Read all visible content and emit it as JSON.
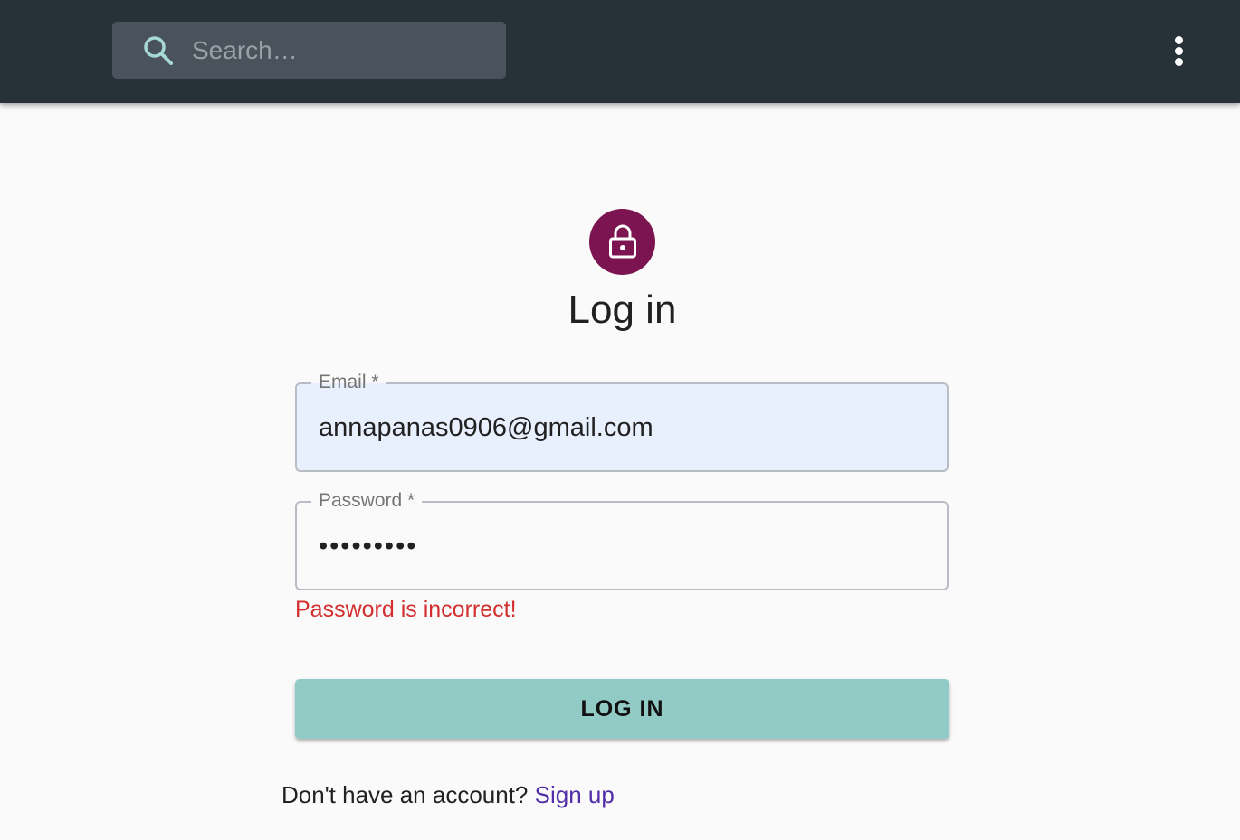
{
  "search": {
    "placeholder": "Search…"
  },
  "header": {
    "menu_icon": "more-vert-icon"
  },
  "login": {
    "icon": "lock-icon",
    "title": "Log in",
    "email_label": "Email *",
    "email_value": "annapanas0906@gmail.com",
    "password_label": "Password *",
    "password_value": "•••••••••",
    "error": "Password is incorrect!",
    "submit_label": "LOG IN",
    "footer_prompt": "Don't have an account?",
    "signup_link": "Sign up"
  },
  "colors": {
    "appbar": "#263238",
    "accent": "#92cac5",
    "avatar": "#7b1450",
    "error": "#d32f2f",
    "link": "#512da8"
  }
}
